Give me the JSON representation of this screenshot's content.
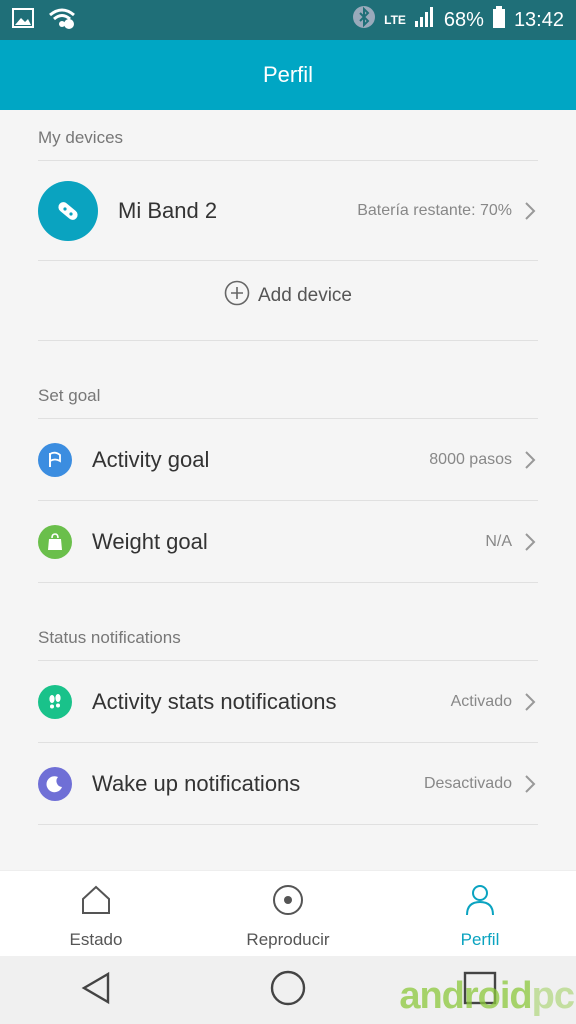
{
  "status_bar": {
    "battery": "68%",
    "time": "13:42",
    "network": "LTE",
    "icons": [
      "image-icon",
      "wifi-icon",
      "bluetooth-icon",
      "signal-icon",
      "battery-icon"
    ]
  },
  "header": {
    "title": "Perfil"
  },
  "my_devices": {
    "section_title": "My devices",
    "device": {
      "name": "Mi Band 2",
      "status": "Batería restante: 70%"
    },
    "add_device": "Add device"
  },
  "set_goal": {
    "section_title": "Set goal",
    "items": [
      {
        "label": "Activity goal",
        "value": "8000 pasos",
        "icon": "flag-icon",
        "color": "#3b8de0"
      },
      {
        "label": "Weight goal",
        "value": "N/A",
        "icon": "weight-icon",
        "color": "#6abf4b"
      }
    ]
  },
  "status_notifications": {
    "section_title": "Status notifications",
    "items": [
      {
        "label": "Activity stats notifications",
        "value": "Activado",
        "icon": "footprints-icon",
        "color": "#19c28a"
      },
      {
        "label": "Wake up notifications",
        "value": "Desactivado",
        "icon": "moon-icon",
        "color": "#6f6fd6"
      }
    ]
  },
  "bottom_nav": {
    "items": [
      {
        "label": "Estado",
        "icon": "home-icon"
      },
      {
        "label": "Reproducir",
        "icon": "record-icon"
      },
      {
        "label": "Perfil",
        "icon": "person-icon"
      }
    ],
    "active": "Perfil"
  },
  "watermark": {
    "part1": "android",
    "part2": "pc"
  },
  "colors": {
    "primary": "#00a6c4",
    "statusbar": "#1f6f78"
  }
}
